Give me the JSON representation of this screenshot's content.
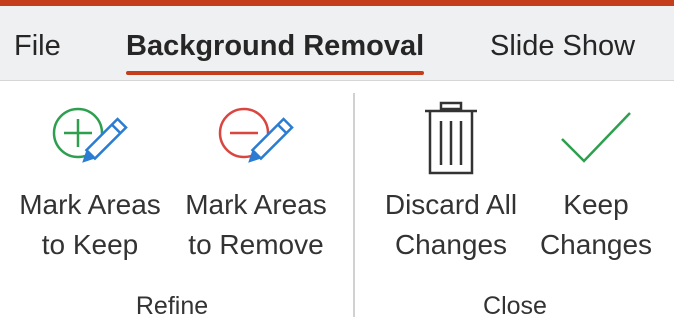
{
  "tabs": [
    {
      "label": "File"
    },
    {
      "label": "Background Removal"
    },
    {
      "label": "Slide Show"
    }
  ],
  "accent_color": "#c43e1c",
  "ribbon": {
    "groups": [
      {
        "label": "Refine",
        "buttons": [
          {
            "line1": "Mark Areas",
            "line2": "to Keep",
            "icon": "pencil-plus-icon"
          },
          {
            "line1": "Mark Areas",
            "line2": "to Remove",
            "icon": "pencil-minus-icon"
          }
        ]
      },
      {
        "label": "Close",
        "buttons": [
          {
            "line1": "Discard All",
            "line2": "Changes",
            "icon": "trash-icon"
          },
          {
            "line1": "Keep",
            "line2": "Changes",
            "icon": "checkmark-icon"
          }
        ]
      }
    ]
  },
  "icon_colors": {
    "keep": "#2e9e4f",
    "remove": "#d9453f",
    "pencil": "#2b7cd3",
    "check": "#2e9e4f",
    "trash": "#333333"
  }
}
